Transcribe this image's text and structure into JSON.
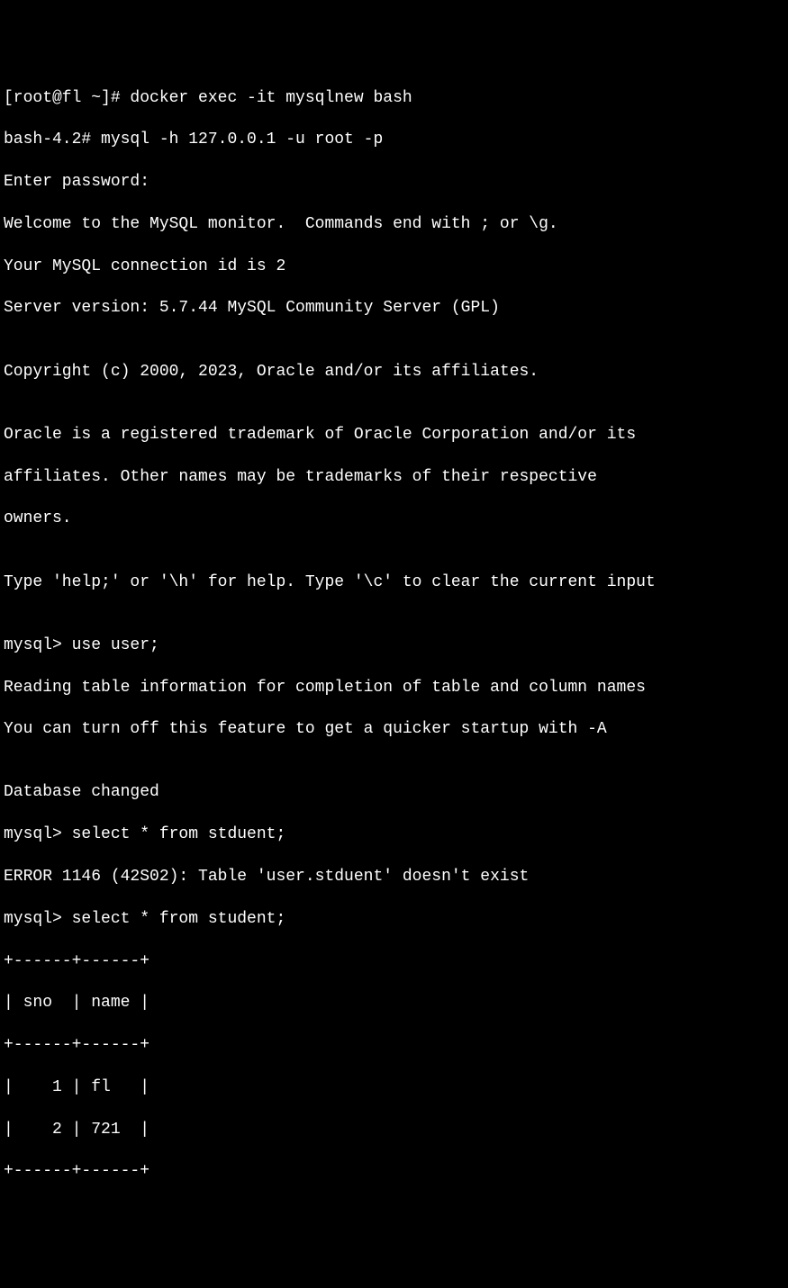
{
  "lines": {
    "l1": "[root@fl ~]# docker exec -it mysqlnew bash",
    "l2": "bash-4.2# mysql -h 127.0.0.1 -u root -p",
    "l3": "Enter password:",
    "l4": "Welcome to the MySQL monitor.  Commands end with ; or \\g.",
    "l5": "Your MySQL connection id is 2",
    "l6": "Server version: 5.7.44 MySQL Community Server (GPL)",
    "l7": "",
    "l8": "Copyright (c) 2000, 2023, Oracle and/or its affiliates.",
    "l9": "",
    "l10": "Oracle is a registered trademark of Oracle Corporation and/or its",
    "l11": "affiliates. Other names may be trademarks of their respective",
    "l12": "owners.",
    "l13": "",
    "l14": "Type 'help;' or '\\h' for help. Type '\\c' to clear the current input",
    "l15": "",
    "l16": "mysql> use user;",
    "l17": "Reading table information for completion of table and column names",
    "l18": "You can turn off this feature to get a quicker startup with -A",
    "l19": "",
    "l20": "Database changed",
    "l21": "mysql> select * from stduent;",
    "l22": "ERROR 1146 (42S02): Table 'user.stduent' doesn't exist",
    "l23": "mysql> select * from student;",
    "l24": "+------+------+",
    "l25": "| sno  | name |",
    "l26": "+------+------+",
    "l27": "|    1 | fl   |",
    "l28": "|    2 | 721  |",
    "l29": "+------+------+"
  }
}
